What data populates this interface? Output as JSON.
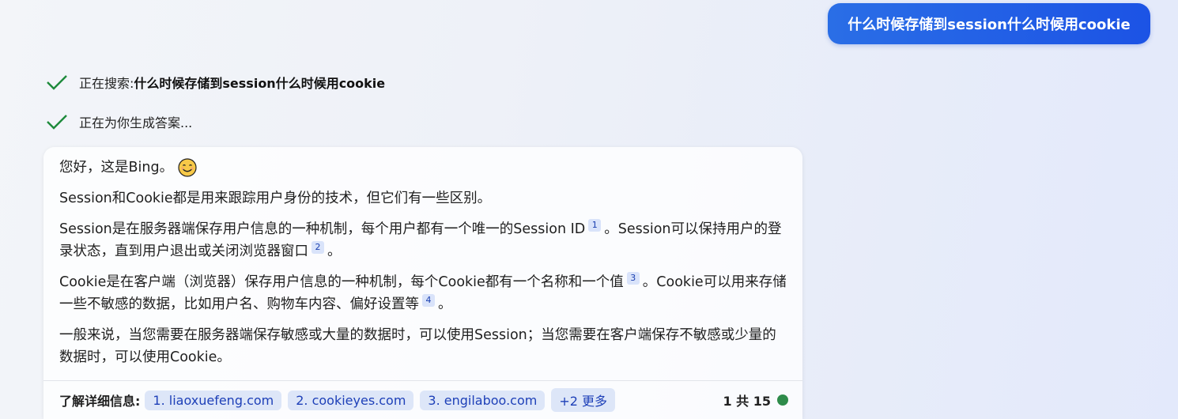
{
  "user_message": "什么时候存储到session什么时候用cookie",
  "status": {
    "searching_label": "正在搜索: ",
    "searching_query": "什么时候存储到session什么时候用cookie",
    "generating_label": "正在为你生成答案..."
  },
  "answer": {
    "greeting": "您好，这是Bing。",
    "p1": "Session和Cookie都是用来跟踪用户身份的技术，但它们有一些区别。",
    "p2_a": "Session是在服务器端保存用户信息的一种机制，每个用户都有一个唯一的Session ID",
    "p2_cite1": "1",
    "p2_b": "。Session可以保持用户的登录状态，直到用户退出或关闭浏览器窗口",
    "p2_cite2": "2",
    "p2_c": "。",
    "p3_a": "Cookie是在客户端（浏览器）保存用户信息的一种机制，每个Cookie都有一个名称和一个值",
    "p3_cite1": "3",
    "p3_b": "。Cookie可以用来存储一些不敏感的数据，比如用户名、购物车内容、偏好设置等",
    "p3_cite2": "4",
    "p3_c": "。",
    "p4": "一般来说，当您需要在服务器端保存敏感或大量的数据时，可以使用Session；当您需要在客户端保存不敏感或少量的数据时，可以使用Cookie。"
  },
  "footer": {
    "learn_more_label": "了解详细信息:",
    "sources": [
      "1. liaoxuefeng.com",
      "2. cookieyes.com",
      "3. engilaboo.com"
    ],
    "more_label": "+2 更多",
    "count_label": "1 共 15",
    "status_color": "#2e8b4a"
  },
  "colors": {
    "user_bubble": "#1c53e5",
    "check": "#1e8a3c"
  }
}
